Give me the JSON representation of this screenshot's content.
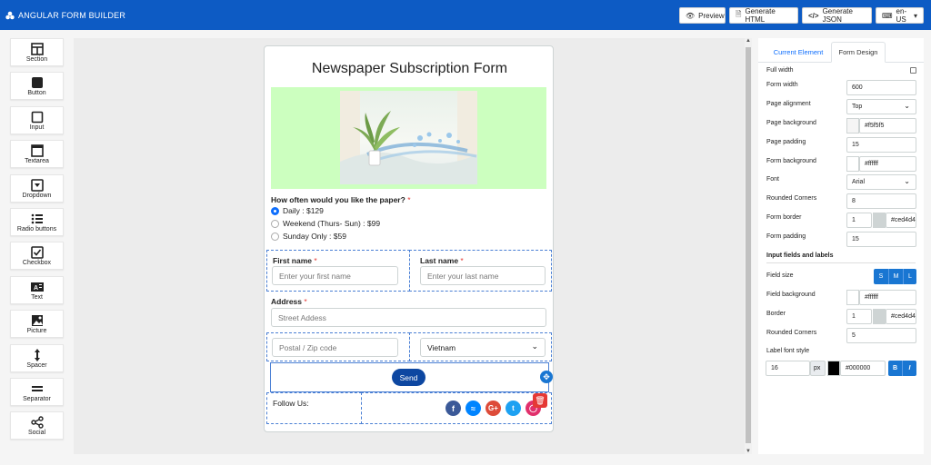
{
  "app": {
    "title": "ANGULAR FORM BUILDER"
  },
  "toolbar": {
    "preview": "Preview",
    "generate_html": "Generate HTML",
    "generate_json": "Generate JSON",
    "locale": "en-US"
  },
  "tools": [
    "Section",
    "Button",
    "Input",
    "Textarea",
    "Dropdown",
    "Radio buttons",
    "Checkbox",
    "Text",
    "Picture",
    "Spacer",
    "Separator",
    "Social"
  ],
  "form": {
    "title": "Newspaper Subscription Form",
    "question": "How often would you like the paper?",
    "required_mark": "*",
    "options": [
      "Daily : $129",
      "Weekend (Thurs- Sun) : $99",
      "Sunday Only : $59"
    ],
    "selected_option": 0,
    "first_name_label": "First name",
    "first_name_placeholder": "Enter your first name",
    "last_name_label": "Last name",
    "last_name_placeholder": "Enter your last name",
    "address_label": "Address",
    "address_placeholder": "Street Addess",
    "postal_placeholder": "Postal / Zip code",
    "country_value": "Vietnam",
    "send_label": "Send",
    "follow_label": "Follow Us:",
    "social_icons": [
      "facebook-icon",
      "messenger-icon",
      "google-plus-icon",
      "twitter-icon",
      "instagram-icon"
    ]
  },
  "panel": {
    "tab_current": "Current Element",
    "tab_design": "Form Design",
    "full_width_label": "Full width",
    "form_width_label": "Form width",
    "form_width_value": "600",
    "page_alignment_label": "Page alignment",
    "page_alignment_value": "Top",
    "page_background_label": "Page background",
    "page_background_value": "#f5f5f5",
    "page_padding_label": "Page padding",
    "page_padding_value": "15",
    "form_background_label": "Form background",
    "form_background_value": "#ffffff",
    "font_label": "Font",
    "font_value": "Arial",
    "rounded_corners_label": "Rounded Corners",
    "rounded_corners_value": "8",
    "form_border_label": "Form border",
    "form_border_width": "1",
    "form_border_color": "#ced4d4",
    "form_padding_label": "Form padding",
    "form_padding_value": "15",
    "input_section_label": "Input fields and labels",
    "field_size_label": "Field size",
    "field_sizes": [
      "S",
      "M",
      "L"
    ],
    "field_background_label": "Field background",
    "field_background_value": "#ffffff",
    "border_label": "Border",
    "border_width": "1",
    "border_color": "#ced4d4",
    "rounded_corners2_label": "Rounded Corners",
    "rounded_corners2_value": "5",
    "label_font_style_label": "Label font style",
    "label_font_size": "16",
    "label_font_unit": "px",
    "label_font_color": "#000000",
    "bold_label": "B",
    "italic_label": "I"
  },
  "colors": {
    "accent": "#0d5bc4",
    "primary": "#1976d2",
    "send": "#0d47a1",
    "dashed": "#4a7fd4",
    "banner": "#ccffbf"
  }
}
